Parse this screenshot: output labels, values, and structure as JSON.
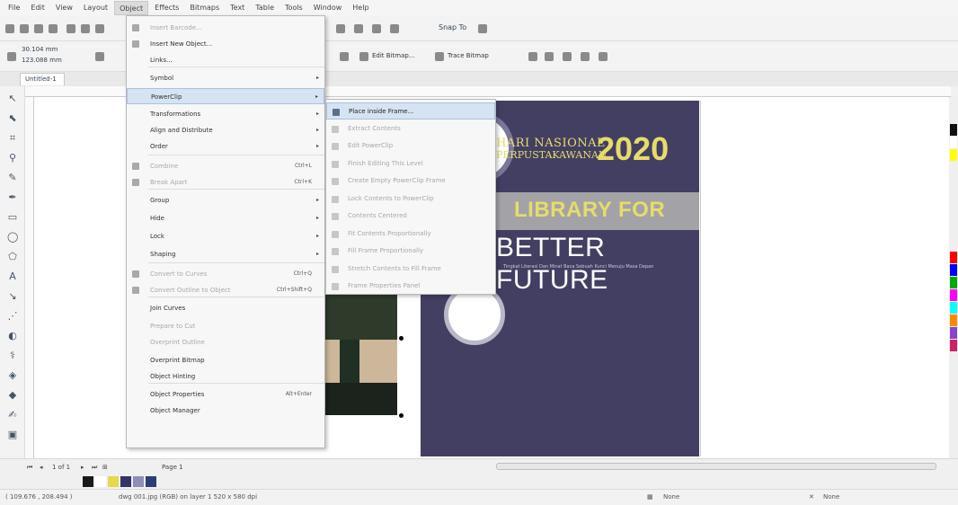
{
  "menubar": {
    "items": [
      "File",
      "Edit",
      "View",
      "Layout",
      "Object",
      "Effects",
      "Bitmaps",
      "Text",
      "Table",
      "Tools",
      "Window",
      "Help"
    ],
    "active": "Object"
  },
  "toolbar": {
    "snap_to": "Snap To"
  },
  "propbar": {
    "x_value": "30.104 mm",
    "y_value": "123.088 mm",
    "edit_bitmap": "Edit Bitmap...",
    "trace_bitmap": "Trace Bitmap"
  },
  "document": {
    "tab": "Untitled-1"
  },
  "object_menu": {
    "items": [
      {
        "label": "Insert Barcode...",
        "state": "disabled",
        "icon": "barcode-icon"
      },
      {
        "label": "Insert New Object...",
        "state": "enabled",
        "icon": "insert-object-icon"
      },
      {
        "label": "Links...",
        "state": "enabled"
      },
      {
        "label": "Symbol",
        "state": "enabled",
        "submenu": true
      },
      {
        "label": "PowerClip",
        "state": "highlight",
        "submenu": true
      },
      {
        "label": "Transformations",
        "state": "enabled",
        "submenu": true
      },
      {
        "label": "Align and Distribute",
        "state": "enabled",
        "submenu": true
      },
      {
        "label": "Order",
        "state": "enabled",
        "submenu": true
      },
      {
        "label": "Combine",
        "state": "disabled",
        "shortcut": "Ctrl+L",
        "icon": "combine-icon"
      },
      {
        "label": "Break Apart",
        "state": "disabled",
        "shortcut": "Ctrl+K",
        "icon": "break-apart-icon"
      },
      {
        "label": "Group",
        "state": "enabled",
        "submenu": true
      },
      {
        "label": "Hide",
        "state": "enabled",
        "submenu": true
      },
      {
        "label": "Lock",
        "state": "enabled",
        "submenu": true
      },
      {
        "label": "Shaping",
        "state": "enabled",
        "submenu": true
      },
      {
        "label": "Convert to Curves",
        "state": "disabled",
        "shortcut": "Ctrl+Q",
        "icon": "convert-curves-icon"
      },
      {
        "label": "Convert Outline to Object",
        "state": "disabled",
        "shortcut": "Ctrl+Shift+Q",
        "icon": "outline-object-icon"
      },
      {
        "label": "Join Curves",
        "state": "enabled"
      },
      {
        "label": "Prepare to Cut",
        "state": "disabled"
      },
      {
        "label": "Overprint Outline",
        "state": "disabled"
      },
      {
        "label": "Overprint Bitmap",
        "state": "enabled"
      },
      {
        "label": "Object Hinting",
        "state": "enabled"
      },
      {
        "label": "Object Properties",
        "state": "enabled",
        "shortcut": "Alt+Enter"
      },
      {
        "label": "Object Manager",
        "state": "enabled"
      }
    ]
  },
  "powerclip_submenu": {
    "items": [
      {
        "label": "Place inside Frame...",
        "state": "highlight"
      },
      {
        "label": "Extract Contents",
        "state": "disabled"
      },
      {
        "label": "Edit PowerClip",
        "state": "disabled"
      },
      {
        "label": "Finish Editing This Level",
        "state": "disabled"
      },
      {
        "label": "Create Empty PowerClip Frame",
        "state": "disabled"
      },
      {
        "label": "Lock Contents to PowerClip",
        "state": "disabled"
      },
      {
        "label": "Contents Centered",
        "state": "disabled"
      },
      {
        "label": "Fit Contents Proportionally",
        "state": "disabled"
      },
      {
        "label": "Fill Frame Proportionally",
        "state": "disabled"
      },
      {
        "label": "Stretch Contents to Fill Frame",
        "state": "disabled"
      },
      {
        "label": "Frame Properties Panel",
        "state": "disabled"
      }
    ]
  },
  "poster": {
    "title_line1": "HARI NASIONAL",
    "title_line2": "PERPUSTAKAWANAN",
    "year": "2020",
    "headline1": "LIBRARY FOR",
    "headline2": "BETTER FUTURE",
    "tagline": "Tingkat Literasi Dan Minat Baca Sebuah Kunci Menuju Masa Depan",
    "colors": {
      "background": "#433f63",
      "accent": "#e7dc69",
      "band": "#a3a3a7"
    }
  },
  "pagebar": {
    "page_counter": "1 of 1",
    "page_tab": "Page 1"
  },
  "statusbar": {
    "coords": "( 109.676 , 208.494 )",
    "object_info": "dwg 001.jpg (RGB) on layer 1 520 x 580 dpi",
    "fill_none": "None",
    "outline_none": "None"
  },
  "colors": {
    "doc_palette": [
      "#1a1a1a",
      "#ffffff",
      "#e5d84a",
      "#363366",
      "#8f8fb5",
      "#2c3e78"
    ],
    "palette": [
      "#111111",
      "#ffffff",
      "#ffff00",
      "#ff0000",
      "#0000ff",
      "#00aa00",
      "#ff00ff",
      "#00ffff",
      "#ff8800",
      "#8844cc",
      "#cc2266"
    ]
  }
}
